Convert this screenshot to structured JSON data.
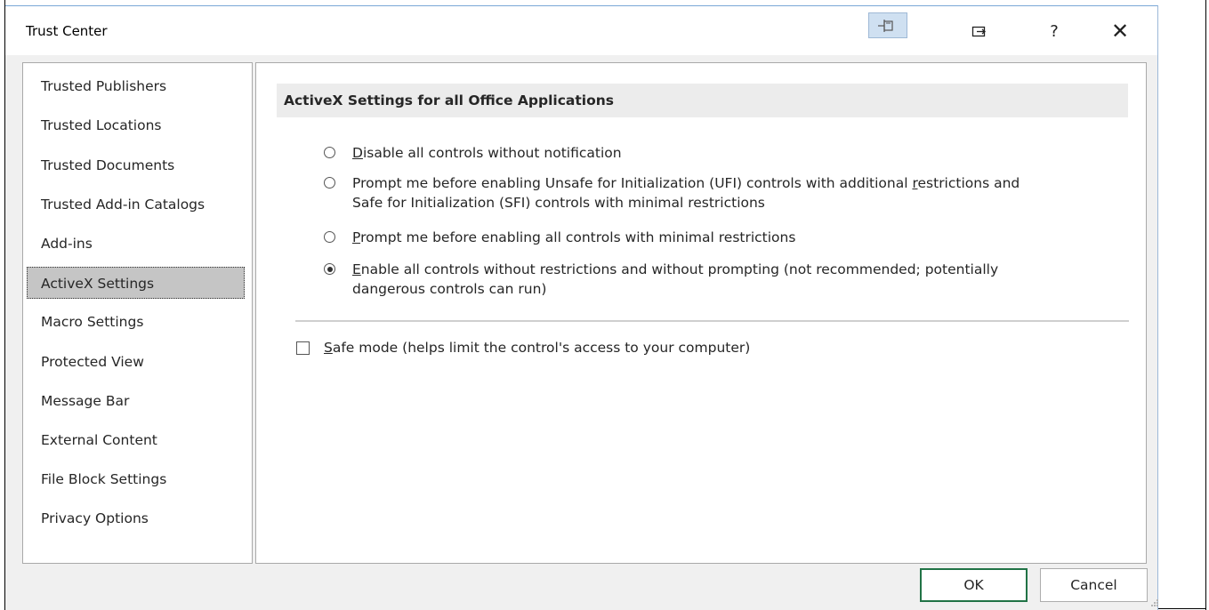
{
  "window": {
    "title": "Trust Center"
  },
  "titlebar": {
    "pin_icon": "pin-icon",
    "restore_icon": "restore-icon",
    "help_label": "?",
    "close_label": "✕"
  },
  "nav": {
    "items": [
      {
        "label": "Trusted Publishers",
        "selected": false
      },
      {
        "label": "Trusted Locations",
        "selected": false
      },
      {
        "label": "Trusted Documents",
        "selected": false
      },
      {
        "label": "Trusted Add-in Catalogs",
        "selected": false
      },
      {
        "label": "Add-ins",
        "selected": false
      },
      {
        "label": "ActiveX Settings",
        "selected": true
      },
      {
        "label": "Macro Settings",
        "selected": false
      },
      {
        "label": "Protected View",
        "selected": false
      },
      {
        "label": "Message Bar",
        "selected": false
      },
      {
        "label": "External Content",
        "selected": false
      },
      {
        "label": "File Block Settings",
        "selected": false
      },
      {
        "label": "Privacy Options",
        "selected": false
      }
    ]
  },
  "main": {
    "section_title": "ActiveX Settings for all Office Applications",
    "options": [
      {
        "pre": "",
        "accel": "D",
        "post": "isable all controls without notification",
        "line2": "",
        "checked": false
      },
      {
        "pre": "Prompt me before enabling Unsafe for Initialization (UFI) controls with additional ",
        "accel": "r",
        "post": "estrictions and",
        "line2": "Safe for Initialization (SFI) controls with minimal restrictions",
        "checked": false
      },
      {
        "pre": "",
        "accel": "P",
        "post": "rompt me before enabling all controls with minimal restrictions",
        "line2": "",
        "checked": false
      },
      {
        "pre": "",
        "accel": "E",
        "post": "nable all controls without restrictions and without prompting (not recommended; potentially",
        "line2": "dangerous controls can run)",
        "checked": true
      }
    ],
    "safe_mode": {
      "accel": "S",
      "post": "afe mode (helps limit the control's access to your computer)",
      "checked": false
    }
  },
  "footer": {
    "ok_label": "OK",
    "cancel_label": "Cancel"
  },
  "colors": {
    "accent_ok_border": "#217346",
    "selected_nav_bg": "#c5c5c5",
    "section_header_bg": "#ececec"
  }
}
